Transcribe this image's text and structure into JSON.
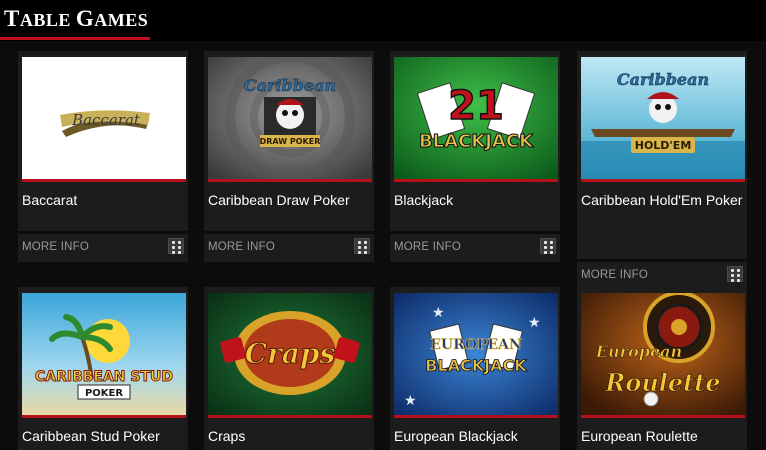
{
  "section": {
    "title_first": "T",
    "title_rest1": "ABLE ",
    "title_second": "G",
    "title_rest2": "AMES"
  },
  "more_info_label": "MORE INFO",
  "games": [
    {
      "name": "Baccarat",
      "logo_text": "Baccarat"
    },
    {
      "name": "Caribbean Draw Poker",
      "logo_text": "Caribbean",
      "logo_sub": "DRAW POKER"
    },
    {
      "name": "Blackjack",
      "logo_text": "21",
      "logo_sub": "BLACKJACK"
    },
    {
      "name": "Caribbean Hold'Em Poker",
      "logo_text": "Caribbean",
      "logo_sub": "HOLD'EM"
    },
    {
      "name": "Caribbean Stud Poker",
      "logo_text": "CARIBBEAN STUD",
      "logo_sub": "POKER"
    },
    {
      "name": "Craps",
      "logo_text": "Craps"
    },
    {
      "name": "European Blackjack",
      "logo_text": "EUROPEAN",
      "logo_sub": "BLACKJACK"
    },
    {
      "name": "European Roulette",
      "logo_text": "European",
      "logo_sub": "Roulette"
    }
  ],
  "colors": {
    "accent_red": "#c3101f",
    "card_bg": "#1c1c1c",
    "page_bg": "#0c0c0c"
  }
}
